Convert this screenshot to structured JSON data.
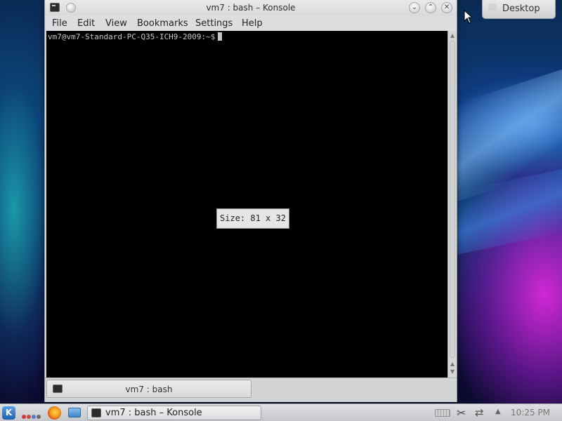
{
  "desktop": {
    "widget_label": "Desktop"
  },
  "window": {
    "title": "vm7 : bash – Konsole",
    "menu": [
      "File",
      "Edit",
      "View",
      "Bookmarks",
      "Settings",
      "Help"
    ],
    "terminal": {
      "prompt": "vm7@vm7-Standard-PC-Q35-ICH9-2009:~$",
      "size_popup": "Size: 81 x 32",
      "background": "#000000",
      "foreground": "#c7c7c7"
    },
    "tab": {
      "label": "vm7 : bash"
    }
  },
  "taskbar": {
    "task_label": "vm7 : bash – Konsole",
    "clock": "10:25 PM",
    "icons": [
      "kickoff-icon",
      "activities-icon",
      "firefox-icon",
      "file-manager-icon",
      "keyboard-icon",
      "klipper-icon",
      "network-icon",
      "expand-tray-icon"
    ]
  }
}
